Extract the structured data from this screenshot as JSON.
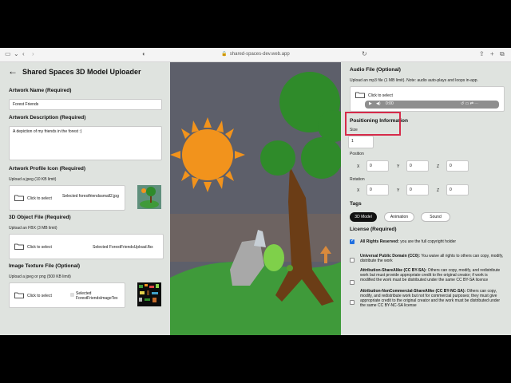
{
  "browser": {
    "url": "shared-spaces-dev.web.app",
    "icons": [
      "sidebar-icon",
      "back-arrow-icon",
      "forward-arrow-icon",
      "shield-icon",
      "refresh-icon",
      "share-icon",
      "plus-icon",
      "tabs-icon"
    ]
  },
  "left": {
    "title": "Shared Spaces 3D Model Uploader",
    "name_label": "Artwork Name (Required)",
    "name_value": "Forest Friends",
    "desc_label": "Artwork Description (Required)",
    "desc_value": "A depiction of my friends in the forest :)",
    "icon_label": "Artwork Profile Icon (Required)",
    "icon_note": "Upload a jpeg (10 KB limit)",
    "icon_click": "Click to select",
    "icon_selected": "Selected forestfriendssmall2.jpg",
    "obj_label": "3D Object File (Required)",
    "obj_note": "Upload an FBX (3 MB limit)",
    "obj_click": "Click to select",
    "obj_selected": "Selected ForestFriendsUpload.fbx",
    "tex_label": "Image Texture File (Optional)",
    "tex_note": "Upload a jpeg or png (500 KB limit)",
    "tex_click": "Click to select",
    "tex_selected": "Selected ForestFriendsImageTex"
  },
  "right": {
    "audio_label": "Audio File (Optional)",
    "audio_note": "Upload an mp3 file (1 MB limit). Note: audio auto-plays and loops in-app.",
    "audio_click": "Click to select",
    "audio_time": "0:00",
    "pos_label": "Positioning Information",
    "size_label": "Size",
    "size_value": "1",
    "position_label": "Position",
    "rotation_label": "Rotation",
    "x": "X",
    "y": "Y",
    "z": "Z",
    "pos_x": "0",
    "pos_y": "0",
    "pos_z": "0",
    "rot_x": "0",
    "rot_y": "0",
    "rot_z": "0",
    "tags_label": "Tags",
    "tags": [
      "3D Model",
      "Animation",
      "Sound"
    ],
    "license_label": "License (Required)",
    "licenses": [
      {
        "bold": "All Rights Reserved:",
        "text": " you are the full copyright holder",
        "checked": true
      },
      {
        "bold": "Universal Public Domain (CC0):",
        "text": " You waive all rights to others can copy, modify, distribute the work",
        "checked": false
      },
      {
        "bold": "Attribution-ShareAlike (CC BY-SA):",
        "text": " Others can copy, modify, and redistribute work but must provide appropriate credit to the original creator; if work is modified the work must be distributed under the same CC BY-SA licence",
        "checked": false
      },
      {
        "bold": "Attribution-NonCommercial-ShareAlike (CC BY-NC-SA):",
        "text": " Others can copy, modify, and redistribute work but not for commercial purposes; they must give appropriate credit to the original creator and the work must be distributed under the same CC BY-NC-SA license",
        "checked": false
      }
    ]
  },
  "colors": {
    "highlight": "#d62b4a",
    "sun": "#f2931c",
    "sky": "#5d5f6a",
    "ground": "#3f9a3a",
    "tree": "#2f8b2a",
    "trunk": "#6b3d16"
  }
}
